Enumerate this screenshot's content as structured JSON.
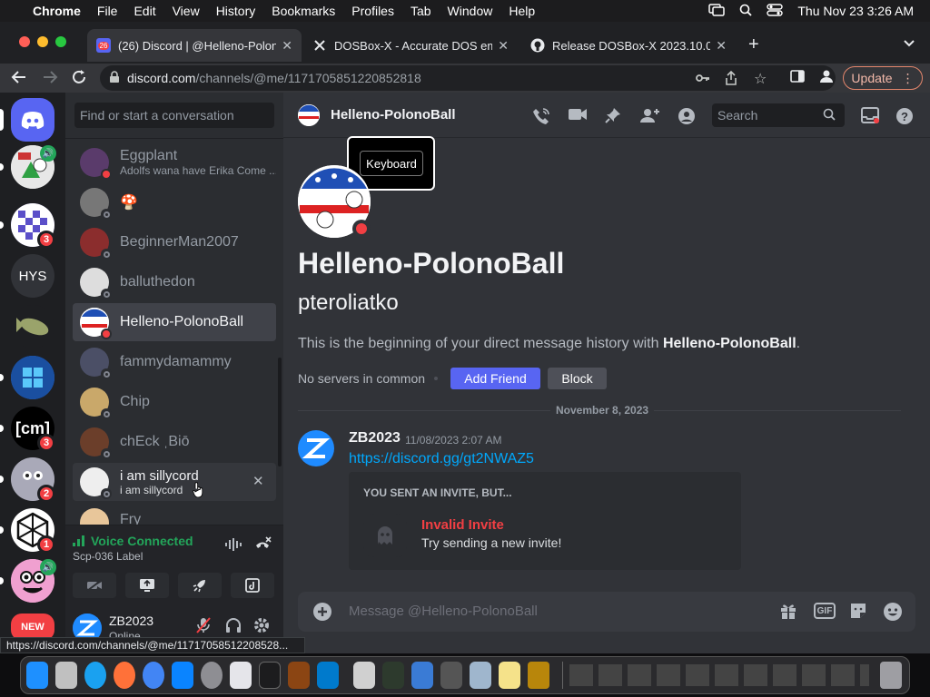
{
  "menubar": {
    "app": "Chrome",
    "items": [
      "File",
      "Edit",
      "View",
      "History",
      "Bookmarks",
      "Profiles",
      "Tab",
      "Window",
      "Help"
    ],
    "clock": "Thu Nov 23  3:26 AM"
  },
  "tabs": [
    {
      "title": "(26) Discord | @Helleno-PolonoBall",
      "badge": "26",
      "active": true
    },
    {
      "title": "DOSBox-X - Accurate DOS emulation",
      "active": false
    },
    {
      "title": "Release DOSBox-X 2023.10.06",
      "active": false
    }
  ],
  "address": {
    "host": "discord.com",
    "path": "/channels/@me/1171705851220852818"
  },
  "toolbar": {
    "update_label": "Update"
  },
  "guilds": {
    "label": "HYS",
    "cm_label": "[cm]",
    "badges": [
      "3",
      "3",
      "2",
      "1"
    ],
    "new_badge": "NEW"
  },
  "dm_list": {
    "search_placeholder": "Find or start a conversation",
    "items": [
      {
        "name": "Eggplant",
        "sub": "Adolfs wana have Erika Come ...",
        "status": "dnd"
      },
      {
        "name": "🍄",
        "status": "offline"
      },
      {
        "name": "BeginnerMan2007",
        "status": "offline"
      },
      {
        "name": "balluthedon",
        "status": "offline"
      },
      {
        "name": "Helleno-PolonoBall",
        "status": "dnd",
        "selected": true
      },
      {
        "name": "fammydamammy",
        "status": "offline"
      },
      {
        "name": "Chip",
        "status": "offline"
      },
      {
        "name": "chEck ˌBiō",
        "status": "offline"
      },
      {
        "name": "i am sillycord",
        "sub": "i am sillycord",
        "status": "offline",
        "hovered": true
      },
      {
        "name": "Fry",
        "status": "offline"
      }
    ]
  },
  "voice": {
    "status": "Voice Connected",
    "channel": "Scp-036 Label"
  },
  "user_panel": {
    "name": "ZB2023",
    "sub": "Online"
  },
  "chat": {
    "header_name": "Helleno-PolonoBall",
    "search_placeholder": "Search",
    "tooltip": "Keyboard",
    "big_name": "Helleno-PolonoBall",
    "username": "pteroliatko",
    "intro_prefix": "This is the beginning of your direct message history with ",
    "intro_name": "Helleno-PolonoBall",
    "intro_suffix": ".",
    "common": "No servers in common",
    "add_friend": "Add Friend",
    "block": "Block",
    "divider_date": "November 8, 2023",
    "message": {
      "author": "ZB2023",
      "timestamp": "11/08/2023 2:07 AM",
      "link": "https://discord.gg/gt2NWAZ5"
    },
    "invite": {
      "heading": "YOU SENT AN INVITE, BUT...",
      "title": "Invalid Invite",
      "subtitle": "Try sending a new invite!"
    },
    "composer_placeholder": "Message @Helleno-PolonoBall",
    "gif_label": "GIF"
  },
  "status_url": "https://discord.com/channels/@me/11717058512208528...",
  "colors": {
    "blurple": "#5865f2",
    "red": "#f23f43",
    "green": "#23a55a",
    "link": "#00a8fc"
  }
}
